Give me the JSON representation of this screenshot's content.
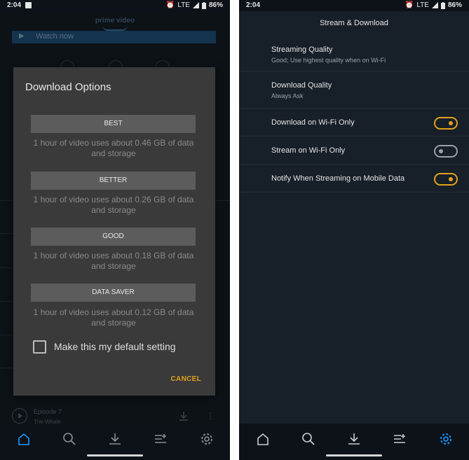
{
  "left_screen": {
    "status_bar": {
      "time": "2:04",
      "network": "LTE",
      "battery": "86%"
    },
    "background": {
      "logo_text": "prime video",
      "watch_button": "Watch now",
      "episode": {
        "title": "Episode 7",
        "subtitle": "The Whale"
      }
    },
    "dialog": {
      "title": "Download Options",
      "options": [
        {
          "label": "BEST",
          "description": "1 hour of video uses about 0.46 GB of data and storage"
        },
        {
          "label": "BETTER",
          "description": "1 hour of video uses about 0.26 GB of data and storage"
        },
        {
          "label": "GOOD",
          "description": "1 hour of video uses about 0.18 GB of data and storage"
        },
        {
          "label": "DATA SAVER",
          "description": "1 hour of video uses about 0.12 GB of data and storage"
        }
      ],
      "default_checkbox_label": "Make this my default setting",
      "default_checked": false,
      "cancel": "CANCEL"
    },
    "nav": {
      "icons": [
        "home-icon",
        "search-icon",
        "download-icon",
        "watchlist-icon",
        "settings-icon"
      ],
      "active": "home-icon",
      "active_color": "#1a98ff"
    }
  },
  "right_screen": {
    "status_bar": {
      "time": "2:04",
      "network": "LTE",
      "battery": "86%"
    },
    "title": "Stream & Download",
    "settings": [
      {
        "label": "Streaming Quality",
        "sub": "Good; Use highest quality when on Wi-Fi"
      },
      {
        "label": "Download Quality",
        "sub": "Always Ask"
      },
      {
        "label": "Download on Wi-Fi Only",
        "toggle": true
      },
      {
        "label": "Stream on Wi-Fi Only",
        "toggle": false
      },
      {
        "label": "Notify When Streaming on Mobile Data",
        "toggle": true
      }
    ],
    "nav": {
      "icons": [
        "home-icon",
        "search-icon",
        "download-icon",
        "watchlist-icon",
        "settings-icon"
      ],
      "active": "settings-icon",
      "active_color": "#1a98ff"
    }
  },
  "colors": {
    "accent_orange": "#e0a21d",
    "toggle_off": "#9aa0a6",
    "nav_inactive": "#c9ced3"
  }
}
